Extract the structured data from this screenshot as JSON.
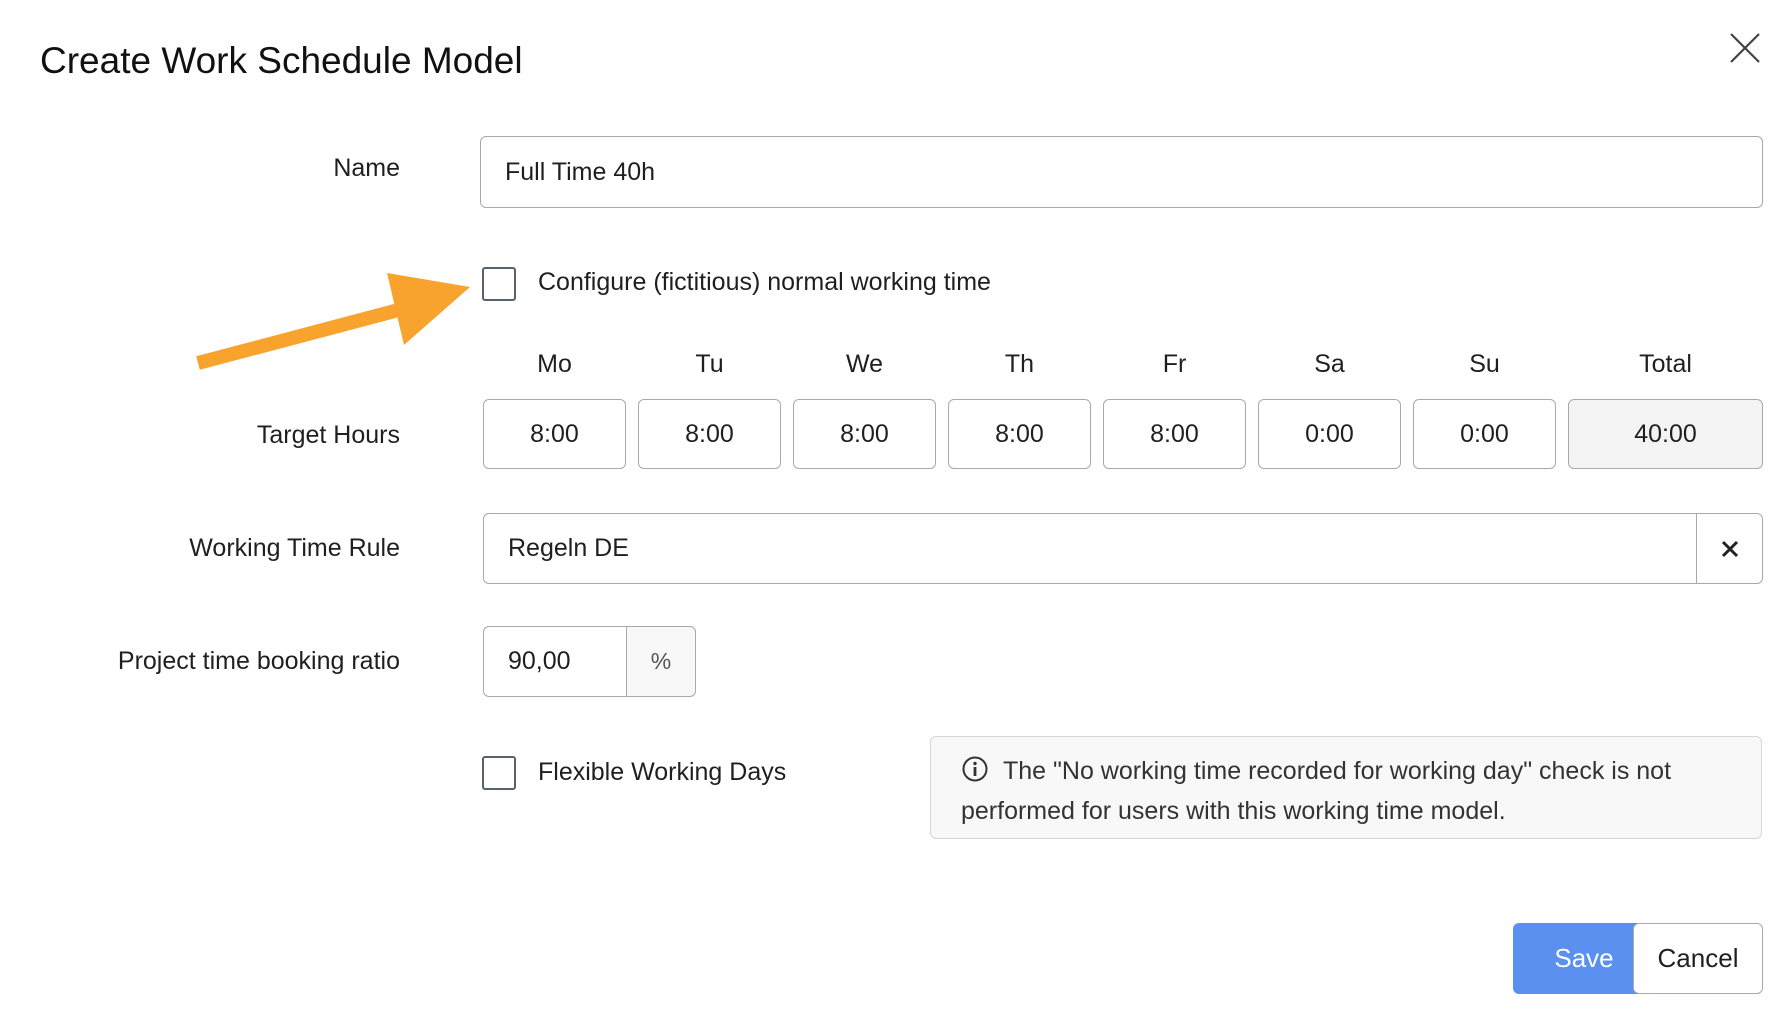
{
  "dialog": {
    "title": "Create Work Schedule Model"
  },
  "form": {
    "name_label": "Name",
    "name_value": "Full Time 40h",
    "normal_time_checkbox_label": "Configure (fictitious) normal working time",
    "normal_time_checked": false,
    "target_hours_label": "Target Hours",
    "days": [
      {
        "label": "Mo",
        "value": "8:00"
      },
      {
        "label": "Tu",
        "value": "8:00"
      },
      {
        "label": "We",
        "value": "8:00"
      },
      {
        "label": "Th",
        "value": "8:00"
      },
      {
        "label": "Fr",
        "value": "8:00"
      },
      {
        "label": "Sa",
        "value": "0:00"
      },
      {
        "label": "Su",
        "value": "0:00"
      }
    ],
    "total_label": "Total",
    "total_value": "40:00",
    "working_time_rule_label": "Working Time Rule",
    "working_time_rule_value": "Regeln DE",
    "booking_ratio_label": "Project time booking ratio",
    "booking_ratio_value": "90,00",
    "booking_ratio_unit": "%",
    "flexible_days_label": "Flexible Working Days",
    "flexible_days_checked": false,
    "info_text": "The \"No working time recorded for working day\" check is not performed for users with this working time model."
  },
  "buttons": {
    "save": "Save",
    "cancel": "Cancel"
  },
  "colors": {
    "primary_button": "#5b8ff0",
    "annotation_arrow": "#f7a32e"
  },
  "icons": {
    "close": "close-icon",
    "clear": "clear-x-icon",
    "info": "info-circle-icon"
  }
}
